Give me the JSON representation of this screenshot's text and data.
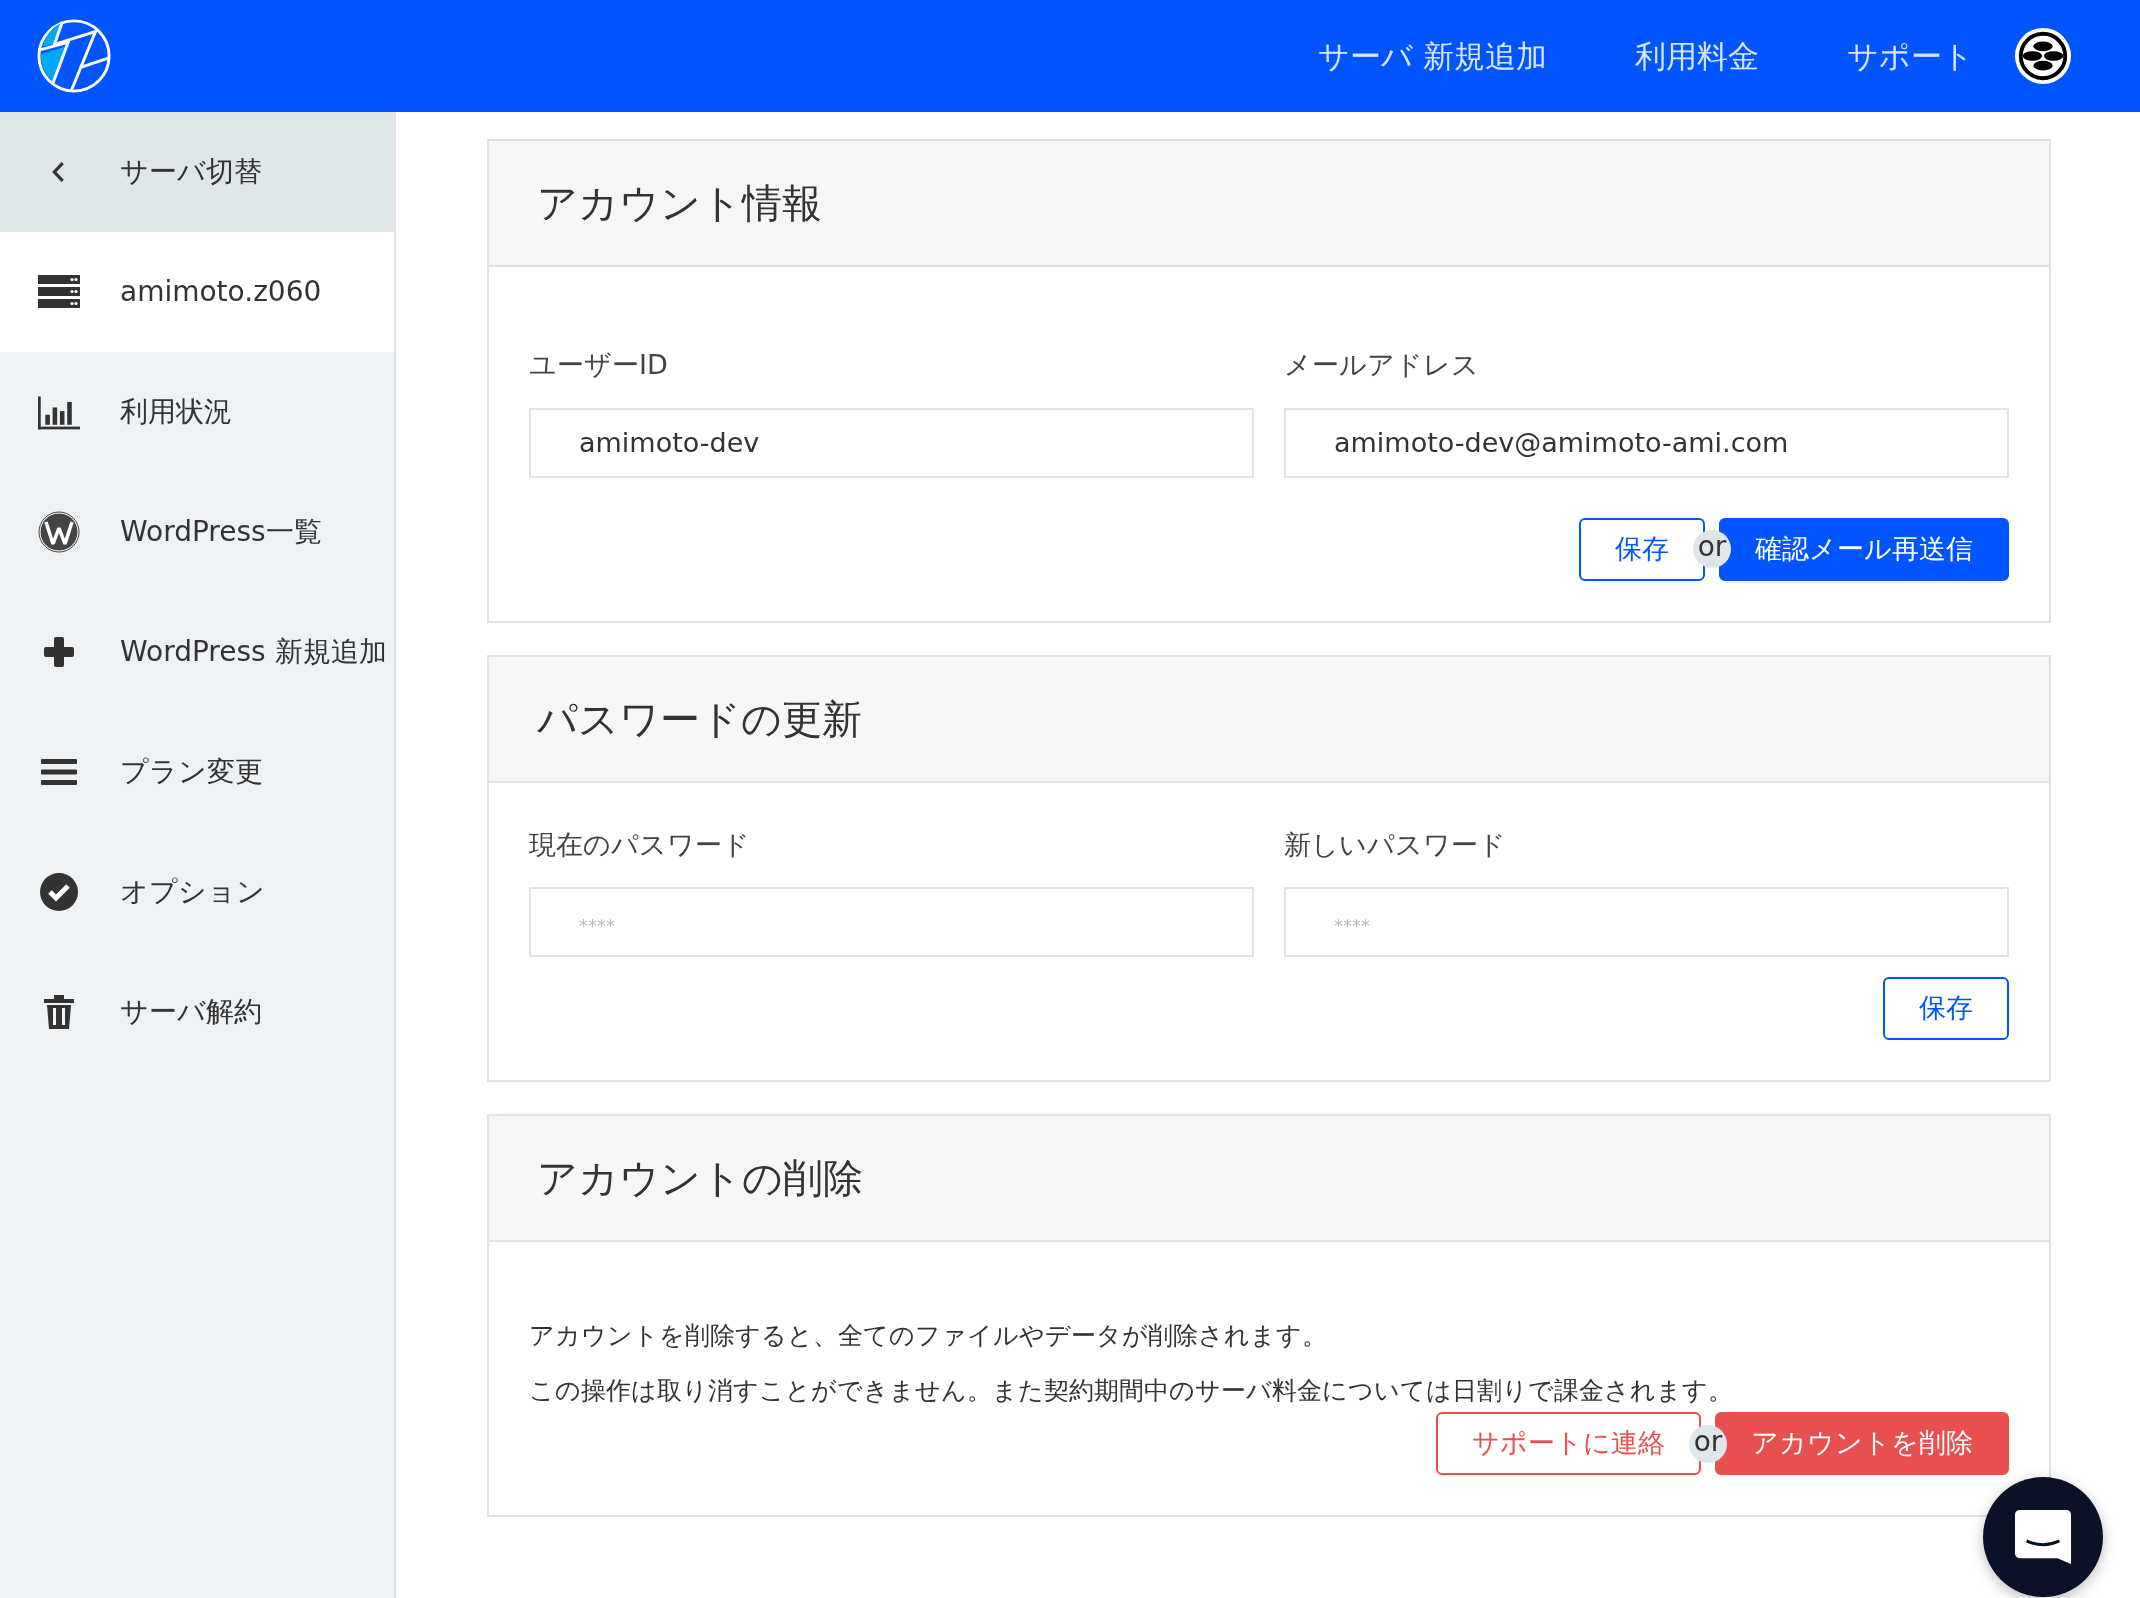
{
  "navbar": {
    "links": [
      "サーバ 新規追加",
      "利用料金",
      "サポート"
    ]
  },
  "sidebar": {
    "back": {
      "label": "サーバ切替"
    },
    "items": [
      {
        "label": "amimoto.z060",
        "selected": true
      },
      {
        "label": "利用状況",
        "selected": false
      },
      {
        "label": "WordPress一覧",
        "selected": false
      },
      {
        "label": "WordPress 新規追加",
        "selected": false
      },
      {
        "label": "プラン変更",
        "selected": false
      },
      {
        "label": "オプション",
        "selected": false
      },
      {
        "label": "サーバ解約",
        "selected": false
      }
    ]
  },
  "account_info": {
    "title": "アカウント情報",
    "fields": [
      {
        "label": "ユーザーID",
        "value": "amimoto-dev"
      },
      {
        "label": "メールアドレス",
        "value": "amimoto-dev@amimoto-ami.com"
      }
    ],
    "buttons": [
      {
        "label": "保存",
        "kind": "outline"
      },
      {
        "label": "or",
        "kind": "separator"
      },
      {
        "label": "確認メール再送信",
        "kind": "solid"
      }
    ]
  },
  "password_update": {
    "title": "パスワードの更新",
    "fields": [
      {
        "label": "現在のパスワード",
        "placeholder": "****"
      },
      {
        "label": "新しいパスワード",
        "placeholder": "****"
      }
    ],
    "buttons": [
      {
        "label": "保存",
        "kind": "outline"
      }
    ]
  },
  "account_delete": {
    "title": "アカウントの削除",
    "paragraphs": [
      "アカウントを削除すると、全てのファイルやデータが削除されます。",
      "この操作は取り消すことができません。また契約期間中のサーバ料金については日割りで課金されます。"
    ],
    "buttons": [
      {
        "label": "サポートに連絡",
        "kind": "outline"
      },
      {
        "label": "or",
        "kind": "separator"
      },
      {
        "label": "アカウントを削除",
        "kind": "solid"
      }
    ]
  }
}
